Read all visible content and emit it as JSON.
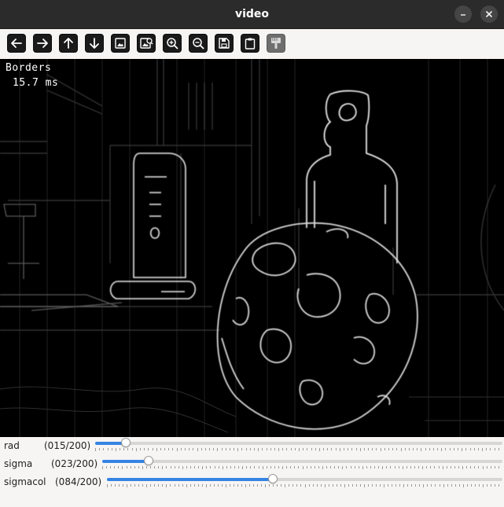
{
  "window": {
    "title": "video",
    "controls": [
      {
        "name": "minimize",
        "icon": "minimize-icon"
      },
      {
        "name": "close",
        "icon": "close-icon"
      }
    ]
  },
  "toolbar": {
    "buttons": [
      {
        "icon": "arrow-left-icon",
        "enabled": true
      },
      {
        "icon": "arrow-right-icon",
        "enabled": true
      },
      {
        "icon": "arrow-up-icon",
        "enabled": true
      },
      {
        "icon": "arrow-down-icon",
        "enabled": true
      },
      {
        "icon": "image-icon",
        "enabled": true
      },
      {
        "icon": "image-zoom-icon",
        "enabled": true
      },
      {
        "icon": "zoom-in-icon",
        "enabled": true
      },
      {
        "icon": "zoom-out-icon",
        "enabled": true
      },
      {
        "icon": "save-icon",
        "enabled": true
      },
      {
        "icon": "clipboard-icon",
        "enabled": true
      },
      {
        "icon": "properties-brush-icon",
        "enabled": false
      }
    ]
  },
  "video": {
    "label": "Borders",
    "timing": "15.7 ms",
    "text_color": "#ffffff"
  },
  "trackbars": [
    {
      "name": "rad",
      "value_text": "(015/200)",
      "value": 15,
      "max": 200
    },
    {
      "name": "sigma",
      "value_text": "(023/200)",
      "value": 23,
      "max": 200
    },
    {
      "name": "sigmacol",
      "value_text": "(084/200)",
      "value": 84,
      "max": 200
    }
  ],
  "colors": {
    "titlebar": "#2b2b2b",
    "accent": "#3584e4",
    "background": "#f6f5f4"
  }
}
